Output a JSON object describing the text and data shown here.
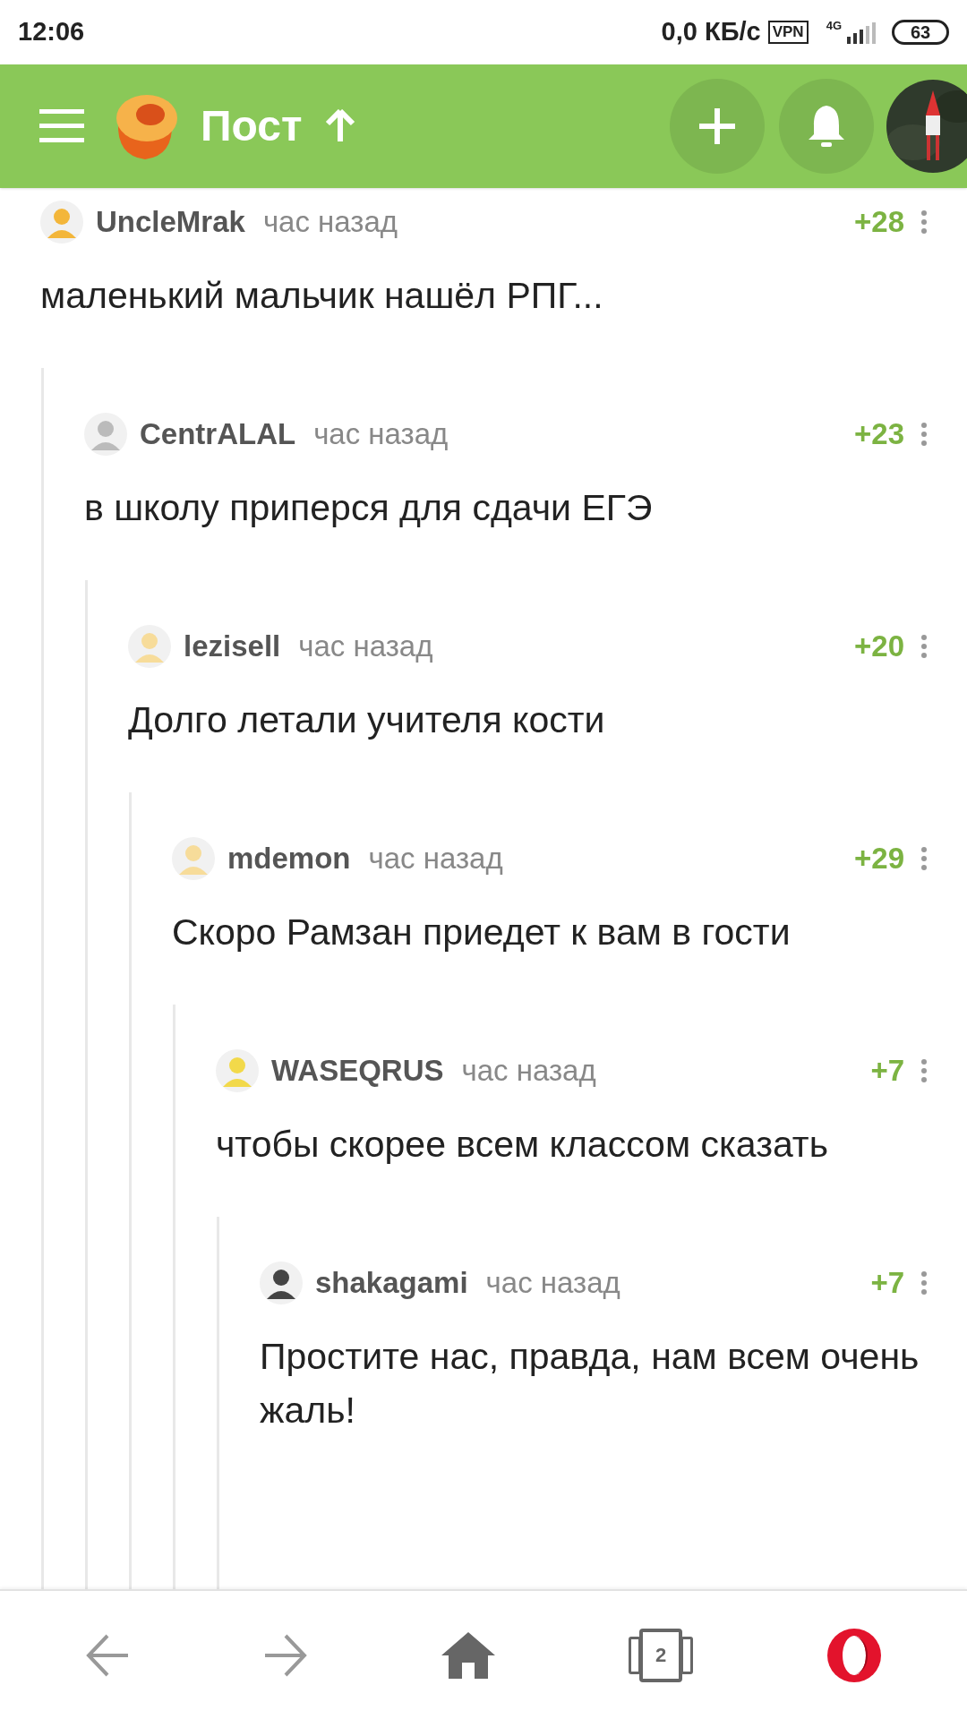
{
  "status_bar": {
    "time": "12:06",
    "speed": "0,0 КБ/с",
    "vpn": "VPN",
    "network": "4G",
    "battery": "63"
  },
  "header": {
    "title": "Пост"
  },
  "comments": [
    {
      "user": "UncleMrak",
      "time": "час назад",
      "rating": "+28",
      "text": "маленький мальчик нашёл РПГ...",
      "children": [
        {
          "user": "CentrALAL",
          "time": "час назад",
          "rating": "+23",
          "text": "в школу приперся для сдачи ЕГЭ",
          "children": [
            {
              "user": "lezisell",
              "time": "час назад",
              "rating": "+20",
              "text": "Долго летали учителя кости",
              "children": [
                {
                  "user": "mdemon",
                  "time": "час назад",
                  "rating": "+29",
                  "text": "Скоро Рамзан приедет к вам в гости",
                  "children": [
                    {
                      "user": "WASEQRUS",
                      "time": "час назад",
                      "rating": "+7",
                      "text": "чтобы скорее всем классом сказать",
                      "children": [
                        {
                          "user": "shakagami",
                          "time": "час назад",
                          "rating": "+7",
                          "text": "Простите нас, правда, нам всем очень жаль!"
                        }
                      ]
                    }
                  ]
                }
              ]
            }
          ]
        }
      ]
    }
  ],
  "bottom_nav": {
    "tabs_count": "2"
  }
}
